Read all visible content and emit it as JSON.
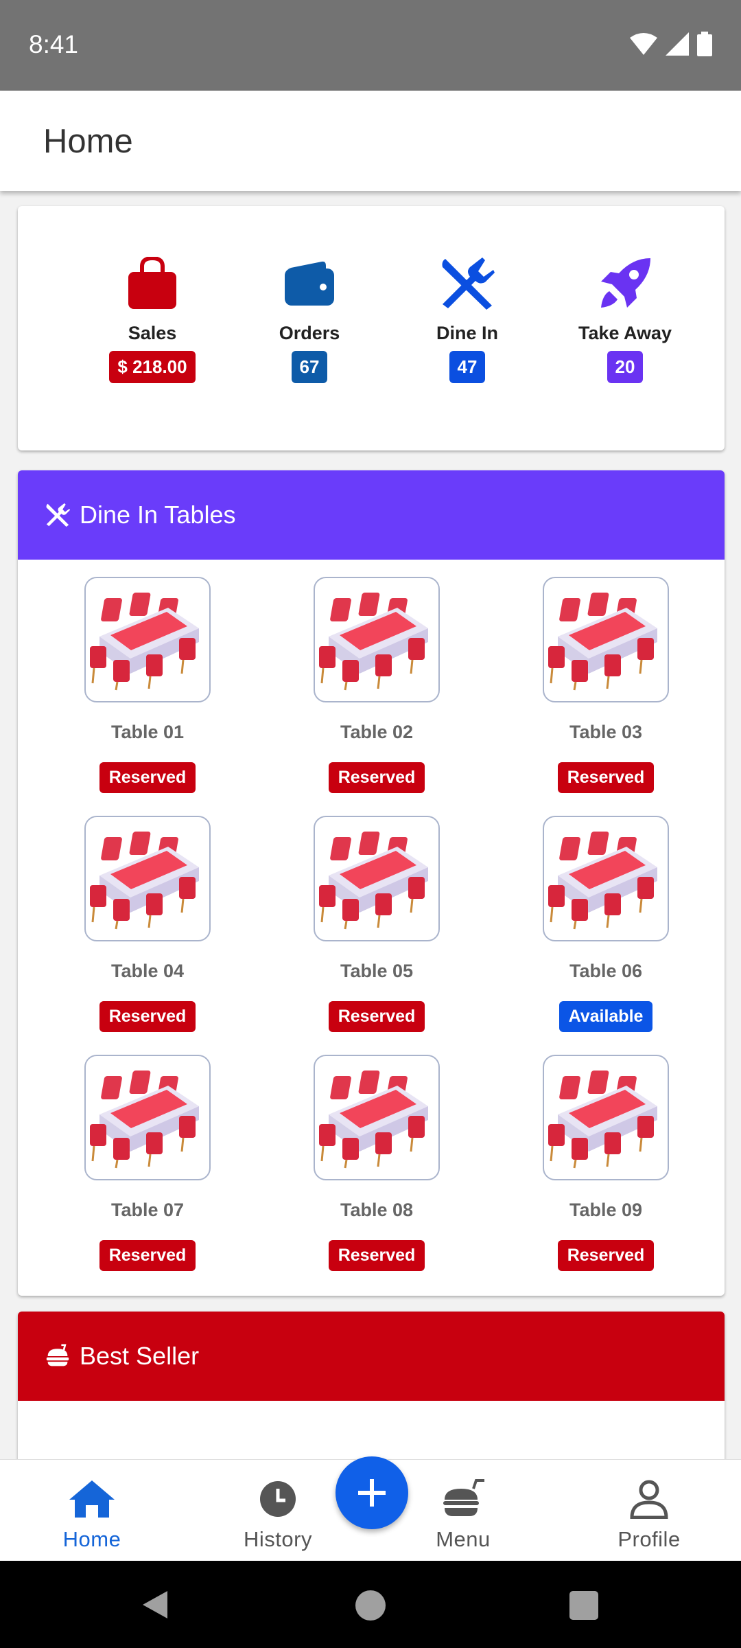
{
  "status_bar": {
    "time": "8:41"
  },
  "app_bar": {
    "title": "Home"
  },
  "stats": [
    {
      "label": "Sales",
      "value": "$ 218.00",
      "color": "#c8000f",
      "icon": "shopping-bag-icon"
    },
    {
      "label": "Orders",
      "value": "67",
      "color": "#0e5ba8",
      "icon": "wallet-icon"
    },
    {
      "label": "Dine In",
      "value": "47",
      "color": "#0b4fe0",
      "icon": "utensils-icon"
    },
    {
      "label": "Take Away",
      "value": "20",
      "color": "#6a33f2",
      "icon": "rocket-icon"
    }
  ],
  "dine_in": {
    "title": "Dine In Tables",
    "color": "#6a3cfa",
    "tables": [
      {
        "name": "Table 01",
        "status": "Reserved"
      },
      {
        "name": "Table 02",
        "status": "Reserved"
      },
      {
        "name": "Table 03",
        "status": "Reserved"
      },
      {
        "name": "Table 04",
        "status": "Reserved"
      },
      {
        "name": "Table 05",
        "status": "Reserved"
      },
      {
        "name": "Table 06",
        "status": "Available"
      },
      {
        "name": "Table 07",
        "status": "Reserved"
      },
      {
        "name": "Table 08",
        "status": "Reserved"
      },
      {
        "name": "Table 09",
        "status": "Reserved"
      }
    ],
    "status_colors": {
      "Reserved": "#c8000f",
      "Available": "#0b55e6"
    }
  },
  "best_seller": {
    "title": "Best Seller",
    "color": "#c8000f"
  },
  "bottom_nav": [
    {
      "label": "Home",
      "icon": "home-icon",
      "active": true
    },
    {
      "label": "History",
      "icon": "clock-icon",
      "active": false
    },
    {
      "label": "Menu",
      "icon": "food-icon",
      "active": false
    },
    {
      "label": "Profile",
      "icon": "person-icon",
      "active": false
    }
  ]
}
